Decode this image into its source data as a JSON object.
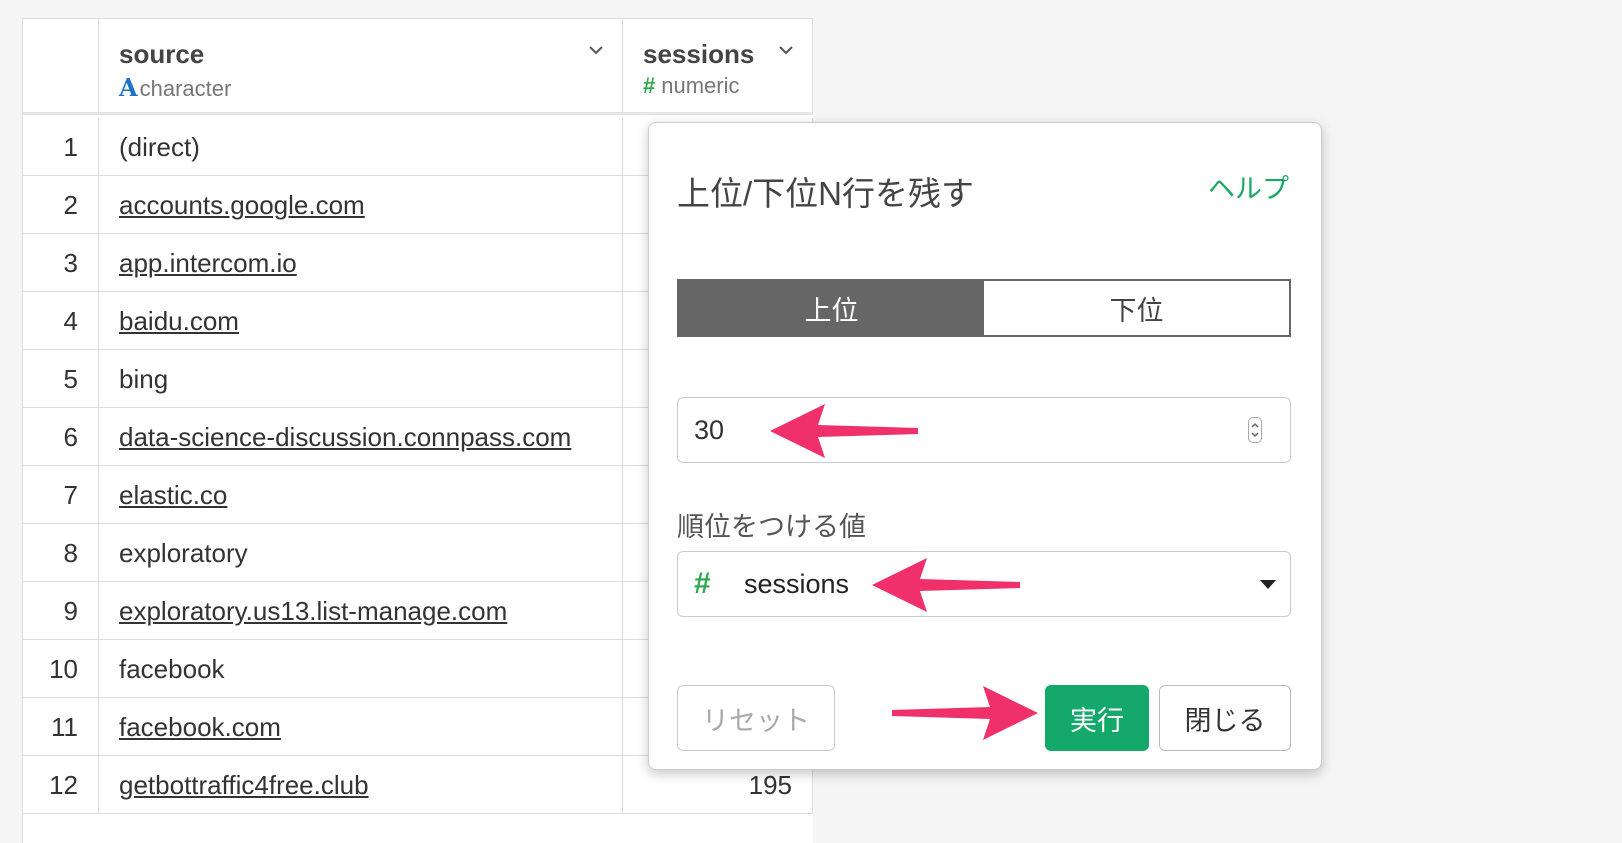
{
  "columns": {
    "source": {
      "name": "source",
      "type_icon": "A",
      "type": "character"
    },
    "sessions": {
      "name": "sessions",
      "type_icon": "#",
      "type": "numeric"
    }
  },
  "rows": [
    {
      "index": "1",
      "source": "(direct)",
      "sessions": ""
    },
    {
      "index": "2",
      "source": "accounts.google.com",
      "sessions": ""
    },
    {
      "index": "3",
      "source": "app.intercom.io",
      "sessions": ""
    },
    {
      "index": "4",
      "source": "baidu.com",
      "sessions": ""
    },
    {
      "index": "5",
      "source": "bing",
      "sessions": ""
    },
    {
      "index": "6",
      "source": "data-science-discussion.connpass.com",
      "sessions": ""
    },
    {
      "index": "7",
      "source": "elastic.co",
      "sessions": ""
    },
    {
      "index": "8",
      "source": "exploratory",
      "sessions": ""
    },
    {
      "index": "9",
      "source": "exploratory.us13.list-manage.com",
      "sessions": ""
    },
    {
      "index": "10",
      "source": "facebook",
      "sessions": ""
    },
    {
      "index": "11",
      "source": "facebook.com",
      "sessions": ""
    },
    {
      "index": "12",
      "source": "getbottraffic4free.club",
      "sessions": "195"
    }
  ],
  "dialog": {
    "title": "上位/下位N行を残す",
    "help": "ヘルプ",
    "toggle": {
      "top": "上位",
      "bottom": "下位",
      "selected": "上位"
    },
    "n_value": "30",
    "rank_label": "順位をつける値",
    "rank_column": {
      "type_icon": "#",
      "value": "sessions"
    },
    "buttons": {
      "reset": "リセット",
      "run": "実行",
      "close": "閉じる"
    }
  },
  "colors": {
    "accent": "#14a86a",
    "arrow": "#f0306a",
    "character_type": "#1a73c8",
    "numeric_type": "#2aa84a"
  }
}
